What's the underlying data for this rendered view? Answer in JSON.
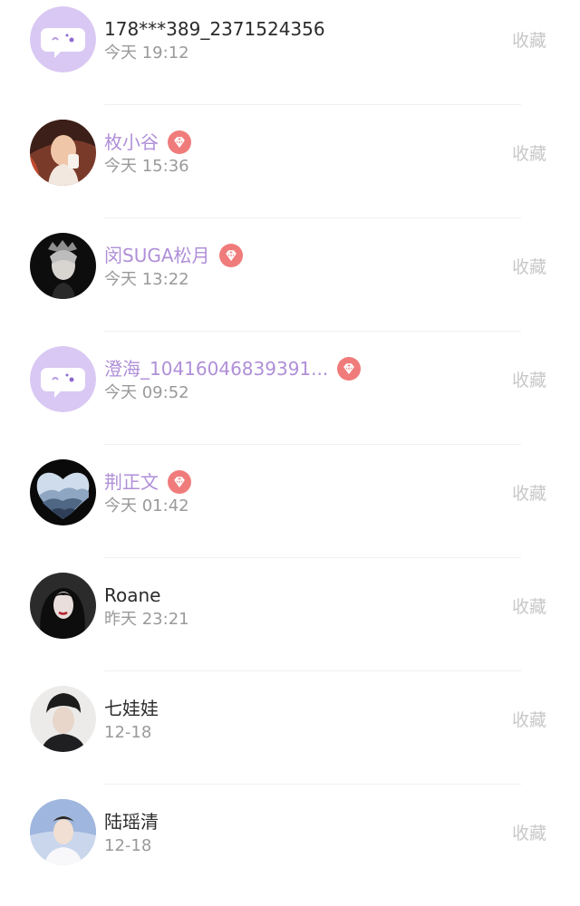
{
  "contacts": [
    {
      "name": "178***389_2371524356",
      "time": "今天 19:12",
      "vip": false,
      "avatar": "default-chat-avatar",
      "collect": "收藏"
    },
    {
      "name": "枚小谷",
      "time": "今天 15:36",
      "vip": true,
      "avatar": "photo-avatar",
      "collect": "收藏"
    },
    {
      "name": "闵SUGA松月",
      "time": "今天 13:22",
      "vip": true,
      "avatar": "photo-avatar",
      "collect": "收藏"
    },
    {
      "name": "澄海_10416046839391...",
      "time": "今天 09:52",
      "vip": true,
      "avatar": "default-chat-avatar",
      "collect": "收藏"
    },
    {
      "name": "荆正文",
      "time": "今天 01:42",
      "vip": true,
      "avatar": "heart-landscape-avatar",
      "collect": "收藏"
    },
    {
      "name": "Roane",
      "time": "昨天 23:21",
      "vip": false,
      "avatar": "photo-avatar",
      "collect": "收藏"
    },
    {
      "name": "七娃娃",
      "time": "12-18",
      "vip": false,
      "avatar": "photo-avatar",
      "collect": "收藏"
    },
    {
      "name": "陆瑶清",
      "time": "12-18",
      "vip": false,
      "avatar": "photo-avatar",
      "collect": "收藏"
    }
  ],
  "colors": {
    "vip_name": "#b08fd8",
    "normal_name": "#2b2b2b",
    "time": "#9a9a9a",
    "collect": "#c8c8c8",
    "vip_badge": "#f07b7b",
    "default_avatar_bg": "#d9c8f3"
  }
}
